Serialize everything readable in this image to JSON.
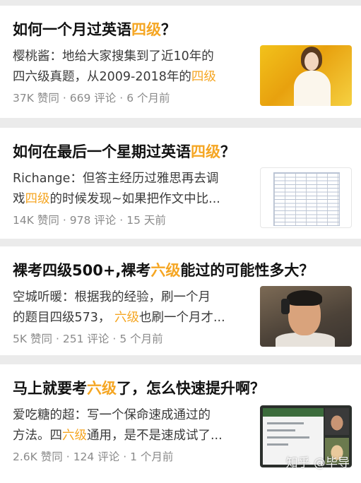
{
  "feed": [
    {
      "title_parts": [
        "如何一个月过英语",
        "四级",
        "？"
      ],
      "excerpt_lines": [
        [
          "樱桃酱：地给大家搜集到了近10年的",
          "",
          ""
        ],
        [
          "四六级真题，从2009-2018年的",
          "四级",
          ""
        ]
      ],
      "votes": "37K 赞同",
      "comments": "669 评论",
      "time": "6 个月前",
      "thumb_icon": "woman-yellow-photo"
    },
    {
      "title_parts": [
        "如何在最后一个星期过英语",
        "四级",
        "？"
      ],
      "excerpt_lines": [
        [
          "Richange：但答主经历过雅思再去调",
          "",
          ""
        ],
        [
          "戏",
          "四级",
          "的时候发现~如果把作文中比..."
        ]
      ],
      "votes": "14K 赞同",
      "comments": "978 评论",
      "time": "15 天前",
      "thumb_icon": "score-table-document"
    },
    {
      "title_parts": [
        "裸考四级500+,裸考",
        "六级",
        "能过的可能性多大？"
      ],
      "excerpt_lines": [
        [
          "空城听暖：根据我的经验，刷一个月",
          "",
          ""
        ],
        [
          "的题目四级573，  ",
          "六级",
          "也刷一个月才..."
        ]
      ],
      "votes": "5K 赞同",
      "comments": "251 评论",
      "time": "5 个月前",
      "thumb_icon": "man-headset-photo"
    },
    {
      "title_parts": [
        "马上就要考",
        "六级",
        "了，怎么快速提升啊？"
      ],
      "excerpt_lines": [
        [
          "爱吃糖的超：写一个保命速成通过的",
          "",
          ""
        ],
        [
          "方法。四",
          "六级",
          "通用，是不是速成试了..."
        ]
      ],
      "votes": "2.6K 赞同",
      "comments": "124 评论",
      "time": "1 个月前",
      "thumb_icon": "screen-recording-webcam"
    }
  ],
  "watermark": "知乎 @毕导",
  "colors": {
    "highlight": "#f5a623",
    "title": "#121212",
    "meta": "#8a8a8a",
    "background": "#ebebeb"
  }
}
